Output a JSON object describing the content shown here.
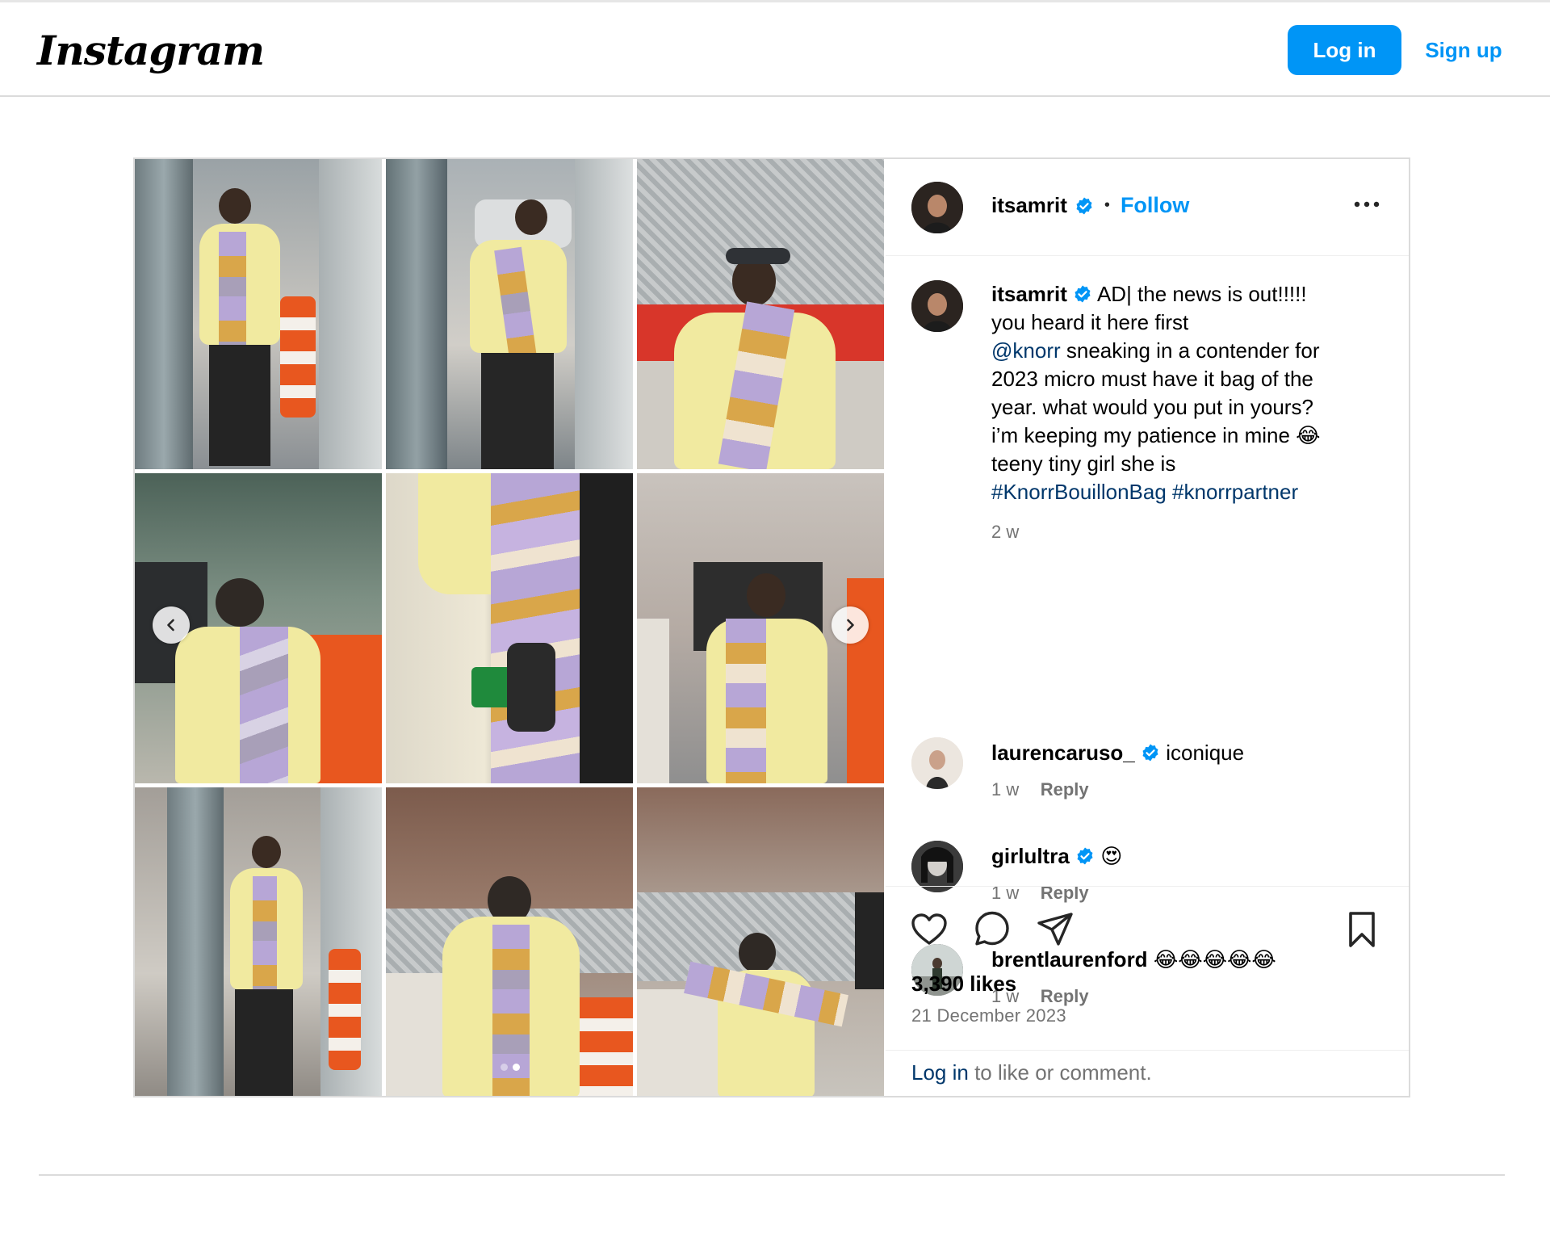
{
  "header": {
    "logo_text": "Instagram",
    "login_label": "Log in",
    "signup_label": "Sign up"
  },
  "post": {
    "author": "itsamrit",
    "follow_label": "Follow",
    "separator": "•",
    "caption": {
      "username": "itsamrit",
      "line1": " AD| the news is out!!!!!",
      "line2": "you heard it here first",
      "mention": "@knorr",
      "line3": " sneaking in a contender for",
      "line4": "2023 micro must have it bag of the",
      "line5": "year. what would you put in yours?",
      "line6": "i’m keeping my patience in mine 😂",
      "line7": "teeny tiny girl she is",
      "hashtag1": "#KnorrBouillonBag",
      "hashtag2": "#knorrpartner",
      "age": "2 w"
    },
    "comments": [
      {
        "username": "laurencaruso_",
        "verified": true,
        "text": "iconique",
        "age": "1 w",
        "reply_label": "Reply"
      },
      {
        "username": "girlultra",
        "verified": true,
        "text": "😍",
        "age": "1 w",
        "reply_label": "Reply"
      },
      {
        "username": "brentlaurenford",
        "verified": false,
        "text": "😂😂😂😂😂",
        "age": "1 w",
        "reply_label": "Reply"
      }
    ],
    "likes": "3,390 likes",
    "date": "21 December 2023",
    "login_prompt": {
      "link": "Log in",
      "rest": " to like or comment."
    },
    "carousel": {
      "current_slide": 2,
      "total_slides": 2
    }
  },
  "colors": {
    "accent": "#0095f6",
    "link": "#00376b",
    "muted": "#737373",
    "border": "#dbdbdb",
    "jacket_yellow": "#f1eaa0",
    "barrier_orange": "#e8571f"
  },
  "icons": [
    "verified-badge-icon",
    "more-options-icon",
    "carousel-prev-icon",
    "carousel-next-icon",
    "heart-icon",
    "comment-icon",
    "share-icon",
    "bookmark-icon"
  ]
}
